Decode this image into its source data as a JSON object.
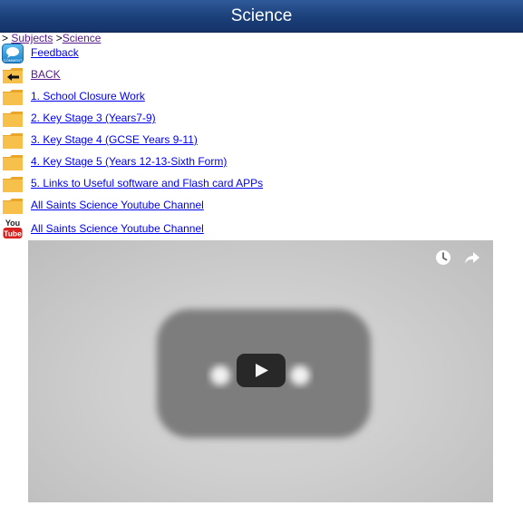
{
  "header": {
    "title": "Science"
  },
  "breadcrumb": {
    "prefix": "> ",
    "subjects": "Subjects",
    "separator": " >",
    "current": "Science"
  },
  "items": [
    {
      "label": "Feedback",
      "icon": "comment-icon"
    },
    {
      "label": "BACK",
      "icon": "back-arrow-folder-icon"
    },
    {
      "label": "1. School Closure Work",
      "icon": "folder-icon"
    },
    {
      "label": "2. Key Stage 3 (Years7-9)",
      "icon": "folder-icon"
    },
    {
      "label": "3. Key Stage 4 (GCSE Years 9-11)",
      "icon": "folder-icon"
    },
    {
      "label": "4. Key Stage 5 (Years 12-13-Sixth Form)",
      "icon": "folder-icon"
    },
    {
      "label": "5. Links to Useful software and Flash card APPs",
      "icon": "folder-icon"
    },
    {
      "label": "All Saints Science Youtube Channel",
      "icon": "folder-icon"
    },
    {
      "label": "All Saints Science Youtube Channel",
      "icon": "youtube-icon"
    }
  ],
  "icon_text": {
    "comment": "COMMENT",
    "youtube_you": "You",
    "youtube_tube": "Tube"
  },
  "colors": {
    "header": "#1b3f78",
    "link": "#0000ee",
    "visited": "#551a8b",
    "folder": "#f5b83a"
  }
}
